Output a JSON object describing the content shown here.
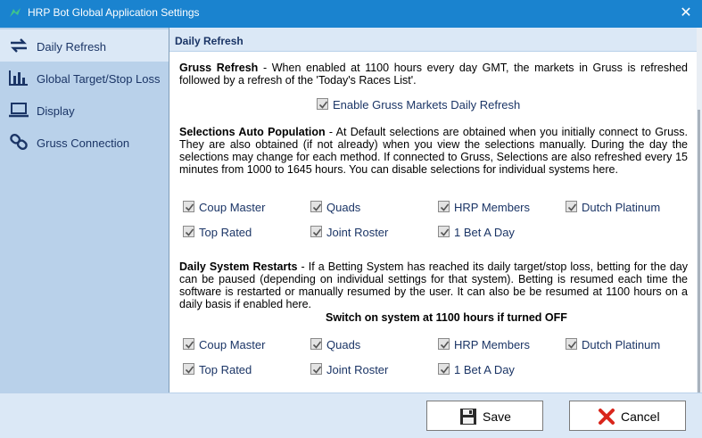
{
  "window": {
    "title": "HRP Bot Global Application Settings",
    "close_glyph": "✕"
  },
  "sidebar": {
    "items": [
      {
        "label": "Daily Refresh",
        "icon": "refresh-icon"
      },
      {
        "label": "Global Target/Stop Loss",
        "icon": "bar-chart-icon"
      },
      {
        "label": "Display",
        "icon": "laptop-icon"
      },
      {
        "label": "Gruss Connection",
        "icon": "link-icon"
      }
    ],
    "active_index": 0
  },
  "main": {
    "header": "Daily Refresh",
    "gruss_refresh": {
      "heading": "Gruss Refresh",
      "text": " - When enabled at 1100 hours every day GMT, the markets in Gruss is refreshed followed by a refresh of the 'Today's Races List'.",
      "checkbox_label": "Enable Gruss Markets Daily Refresh",
      "checked": true
    },
    "selections": {
      "heading": "Selections Auto Population",
      "text": " - At Default selections are obtained when you initially connect to Gruss. They are also obtained (if not already) when you view the selections manually. During the day the selections may change for each method. If connected to Gruss, Selections are also refreshed every 15 minutes from 1000 to 1645 hours. You can disable selections for individual systems here.",
      "systems": [
        "Coup Master",
        "Quads",
        "HRP Members",
        "Dutch Platinum",
        "Top Rated",
        "Joint Roster",
        "1 Bet A Day"
      ]
    },
    "restarts": {
      "heading": "Daily System Restarts",
      "text": " - If a Betting System has reached its daily target/stop loss, betting for the day can be paused (depending on individual settings for that system). Betting is resumed each time the software is restarted or manually resumed by the user. It can also be be resumed at 1100 hours on a daily basis if enabled here.",
      "switch_title": "Switch on system at 1100 hours if turned OFF",
      "systems": [
        "Coup Master",
        "Quads",
        "HRP Members",
        "Dutch Platinum",
        "Top Rated",
        "Joint Roster",
        "1 Bet A Day"
      ]
    }
  },
  "footer": {
    "save_label": "Save",
    "cancel_label": "Cancel"
  },
  "colors": {
    "titlebar": "#1a83cf",
    "sidebar": "#b9d1ea",
    "accent_text": "#1b3566"
  }
}
